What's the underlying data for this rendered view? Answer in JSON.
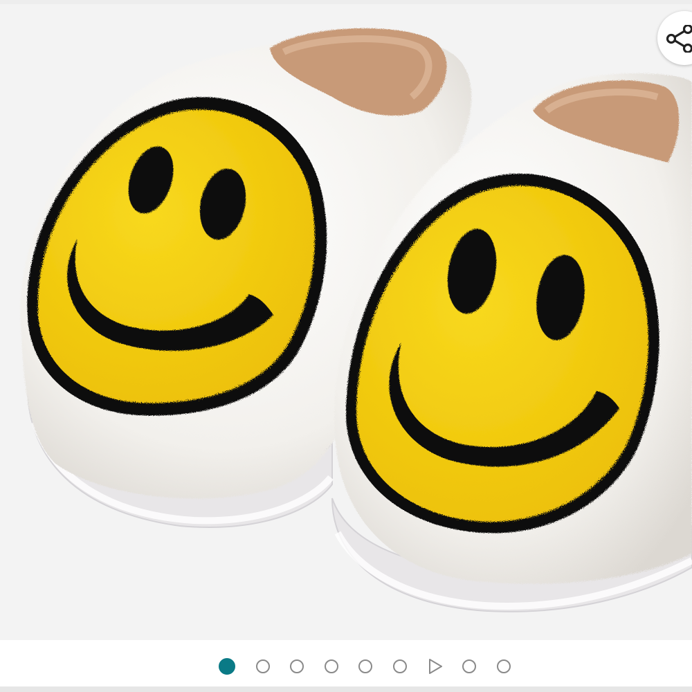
{
  "product_image": {
    "icon": "smiley-slippers-photo",
    "colors": {
      "background": "#f3f3f3",
      "plush": "#f7f5f2",
      "lining": "#c89a78",
      "face": "#f3cc0a",
      "outline": "#111111"
    }
  },
  "share": {
    "icon": "share-icon"
  },
  "carousel": {
    "accent": "#0a7a86",
    "active_index": 0,
    "items": [
      {
        "type": "image"
      },
      {
        "type": "image"
      },
      {
        "type": "image"
      },
      {
        "type": "image"
      },
      {
        "type": "image"
      },
      {
        "type": "image"
      },
      {
        "type": "video",
        "icon": "play-icon"
      },
      {
        "type": "image"
      },
      {
        "type": "image"
      }
    ]
  }
}
